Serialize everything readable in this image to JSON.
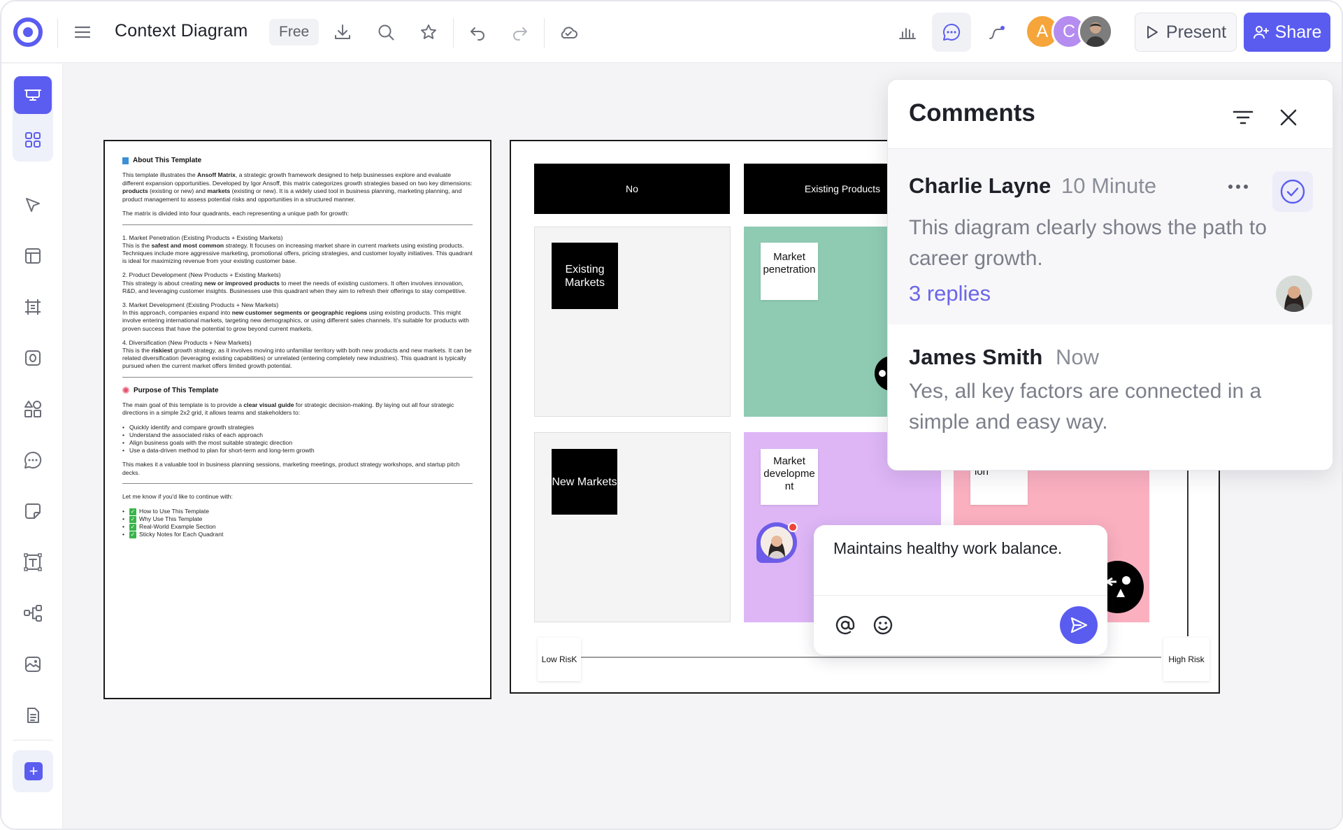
{
  "app": {
    "title": "Context Diagram",
    "plan": "Free"
  },
  "toolbar": {
    "present_label": "Present",
    "share_label": "Share",
    "avatars": [
      {
        "initial": "A",
        "color": "#f5a53a"
      },
      {
        "initial": "C",
        "color": "#b58cf0"
      },
      {
        "initial": "",
        "color": "#5b5b5b"
      }
    ],
    "icons": [
      "menu-icon",
      "download-icon",
      "search-icon",
      "star-icon",
      "undo-icon",
      "redo-icon",
      "cloud-icon",
      "chart-icon",
      "comment-icon",
      "pen-icon"
    ]
  },
  "sidebar": {
    "tools": [
      "presentation-icon",
      "apps-icon",
      "pointer-icon",
      "layout-icon",
      "frame-icon",
      "shape-icon",
      "shapes-icon",
      "comment-icon",
      "sticky-note-icon",
      "text-icon",
      "mindmap-icon",
      "media-icon",
      "document-icon",
      "add-icon"
    ]
  },
  "document": {
    "about_heading": "About This Template",
    "about_p1_a": "This template illustrates the ",
    "about_p1_b": "Ansoff Matrix",
    "about_p1_c": ", a strategic growth framework designed to help businesses explore and evaluate different expansion opportunities. Developed by Igor Ansoff, this matrix categorizes growth strategies based on two key dimensions: ",
    "about_p1_d": "products",
    "about_p1_e": " (existing or new) and ",
    "about_p1_f": "markets",
    "about_p1_g": " (existing or new). It is a widely used tool in business planning, marketing planning, and product management to assess potential risks and opportunities in a structured manner.",
    "about_p2": "The matrix is divided into four quadrants, each representing a unique path for growth:",
    "quadrants": [
      {
        "title": "1. Market Penetration (Existing Products + Existing Markets)",
        "text_a": "This is the ",
        "bold": "safest and most common",
        "text_b": " strategy. It focuses on increasing market share in current markets using existing products. Techniques include more aggressive marketing, promotional offers, pricing strategies, and customer loyalty initiatives. This quadrant is ideal for maximizing revenue from your existing customer base."
      },
      {
        "title": "2. Product Development (New Products + Existing Markets)",
        "text_a": "This strategy is about creating ",
        "bold": "new or improved products",
        "text_b": " to meet the needs of existing customers. It often involves innovation, R&D, and leveraging customer insights. Businesses use this quadrant when they aim to refresh their offerings to stay competitive."
      },
      {
        "title": "3. Market Development (Existing Products + New Markets)",
        "text_a": "In this approach, companies expand into ",
        "bold": "new customer segments or geographic regions",
        "text_b": " using existing products. This might involve entering international markets, targeting new demographics, or using different sales channels. It's suitable for products with proven success that have the potential to grow beyond current markets."
      },
      {
        "title": "4. Diversification (New Products + New Markets)",
        "text_a": "This is the ",
        "bold": "riskiest",
        "text_b": " growth strategy, as it involves moving into unfamiliar territory with both new products and new markets. It can be related diversification (leveraging existing capabilities) or unrelated (entering completely new industries). This quadrant is typically pursued when the current market offers limited growth potential."
      }
    ],
    "purpose_heading": "Purpose of This Template",
    "purpose_p1_a": "The main goal of this template is to provide a ",
    "purpose_p1_b": "clear visual guide",
    "purpose_p1_c": " for strategic decision-making. By laying out all four strategic directions in a simple 2x2 grid, it allows teams and stakeholders to:",
    "purpose_list": [
      "Quickly identify and compare growth strategies",
      "Understand the associated risks of each approach",
      "Align business goals with the most suitable strategic direction",
      "Use a data-driven method to plan for short-term and long-term growth"
    ],
    "purpose_p2": "This makes it a valuable tool in business planning sessions, marketing meetings, product strategy workshops, and startup pitch decks.",
    "continue_text": "Let me know if you'd like to continue with:",
    "continue_list": [
      "How to Use This Template",
      "Why Use This Template",
      "Real-World Example Section",
      "Sticky Notes for Each Quadrant"
    ]
  },
  "matrix": {
    "header_no": "No",
    "header_existing_products": "Existing Products",
    "row1_label": "Existing Markets",
    "row2_label": "New Markets",
    "note_penetration": "Market penetration",
    "note_development": "Market developme nt",
    "note_diversification_partial": "Diversificat ion",
    "low_risk": "Low RisK",
    "high_risk": "High Risk",
    "colors": {
      "green": "#8fcbb3",
      "purple": "#deb6f6",
      "pink": "#fbb0c0"
    }
  },
  "comments": {
    "title": "Comments",
    "items": [
      {
        "author": "Charlie Layne",
        "time": "10 Minute",
        "text": "This diagram clearly shows the path to career growth.",
        "replies": "3 replies"
      },
      {
        "author": "James Smith",
        "time": "Now",
        "text": "Yes, all key factors are connected in a simple and easy way."
      }
    ]
  },
  "composer": {
    "text": "Maintains healthy work balance."
  }
}
